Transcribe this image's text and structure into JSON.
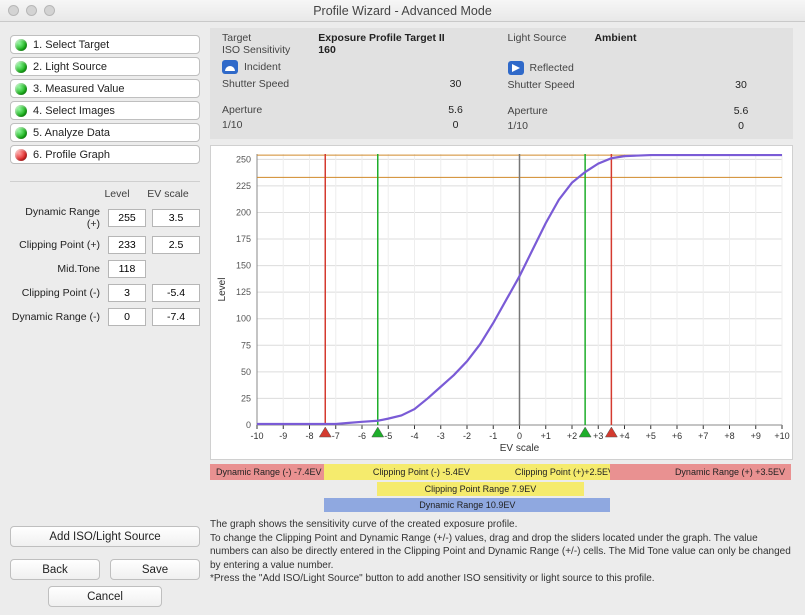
{
  "window": {
    "title": "Profile Wizard - Advanced Mode"
  },
  "nav": {
    "items": [
      {
        "label": "1. Select Target",
        "state": "green"
      },
      {
        "label": "2. Light Source",
        "state": "green"
      },
      {
        "label": "3. Measured Value",
        "state": "green"
      },
      {
        "label": "4. Select Images",
        "state": "green"
      },
      {
        "label": "5. Analyze Data",
        "state": "green"
      },
      {
        "label": "6. Profile Graph",
        "state": "red"
      }
    ]
  },
  "form": {
    "hdr_level": "Level",
    "hdr_evscale": "EV scale",
    "dr_plus_label": "Dynamic Range (+)",
    "dr_plus_level": "255",
    "dr_plus_ev": "3.5",
    "cp_plus_label": "Clipping Point (+)",
    "cp_plus_level": "233",
    "cp_plus_ev": "2.5",
    "mid_label": "Mid.Tone",
    "mid_level": "118",
    "cp_minus_label": "Clipping Point (-)",
    "cp_minus_level": "3",
    "cp_minus_ev": "-5.4",
    "dr_minus_label": "Dynamic Range (-)",
    "dr_minus_level": "0",
    "dr_minus_ev": "-7.4"
  },
  "buttons": {
    "add": "Add ISO/Light Source",
    "back": "Back",
    "save": "Save",
    "cancel": "Cancel"
  },
  "meta": {
    "target_label": "Target",
    "iso_label": "ISO Sensitivity",
    "exposure_label": "Exposure Profile Target II",
    "exposure_value": "160",
    "light_label": "Light Source",
    "light_value": "Ambient",
    "incident_label": "Incident",
    "reflected_label": "Reflected",
    "inc": {
      "shutter_label": "Shutter Speed",
      "shutter": "30",
      "aperture_label": "Aperture",
      "aperture": "5.6",
      "tenth_label": "1/10",
      "tenth": "0"
    },
    "ref": {
      "shutter_label": "Shutter Speed",
      "shutter": "30",
      "aperture_label": "Aperture",
      "aperture": "5.6",
      "tenth_label": "1/10",
      "tenth": "0"
    }
  },
  "axis": {
    "ylabel": "Level",
    "xlabel": "EV scale",
    "yticks": [
      "0",
      "25",
      "50",
      "75",
      "100",
      "125",
      "150",
      "175",
      "200",
      "225",
      "250"
    ],
    "xticks": [
      "-10",
      "-9",
      "-8",
      "-7",
      "-6",
      "-5",
      "-4",
      "-3",
      "-2",
      "-1",
      "0",
      "+1",
      "+2",
      "+3",
      "+4",
      "+5",
      "+6",
      "+7",
      "+8",
      "+9",
      "+10"
    ]
  },
  "chart_data": {
    "type": "line",
    "xlabel": "EV scale",
    "ylabel": "Level",
    "xlim": [
      -10,
      10
    ],
    "ylim": [
      0,
      255
    ],
    "series": [
      {
        "name": "sensitivity",
        "x": [
          -10,
          -9,
          -8,
          -7,
          -6.5,
          -6,
          -5.4,
          -5,
          -4.5,
          -4,
          -3.5,
          -3,
          -2.5,
          -2,
          -1.5,
          -1,
          -0.5,
          0,
          0.5,
          1,
          1.5,
          2,
          2.5,
          3,
          3.5,
          4,
          5,
          6,
          7,
          8,
          9,
          10
        ],
        "y": [
          1,
          1,
          1,
          1,
          2,
          3,
          4,
          6,
          9,
          15,
          25,
          36,
          47,
          60,
          76,
          96,
          118,
          140,
          165,
          190,
          212,
          228,
          238,
          246,
          251,
          253,
          254,
          254,
          254,
          254,
          254,
          254
        ]
      }
    ],
    "markers": {
      "dynamic_range_minus_ev": -7.4,
      "clipping_point_minus_ev": -5.4,
      "clipping_point_plus_ev": 2.5,
      "dynamic_range_plus_ev": 3.5
    },
    "clipping_point_plus_level": 233
  },
  "legend": {
    "dr_minus": "Dynamic Range (-) -7.4EV",
    "cp_minus": "Clipping Point (-) -5.4EV",
    "cp_plus": "Clipping Point (+)+2.5EV",
    "dr_plus": "Dynamic Range (+) +3.5EV",
    "cpr": "Clipping Point Range    7.9EV",
    "dr": "Dynamic Range    10.9EV"
  },
  "help": {
    "l1": "The graph shows the sensitivity curve of the created exposure profile.",
    "l2": "To change the Clipping Point and Dynamic Range (+/-) values, drag and drop the sliders located under the graph. The value numbers can also be directly entered in the Clipping Point and Dynamic Range (+/-) cells. The Mid Tone value can only be changed by entering a value number.",
    "l3": "*Press the \"Add ISO/Light Source\" button to add another ISO sensitivity or light source to this profile."
  },
  "colors": {
    "curve": "#7a5bd6",
    "marker_green": "#1eae2a",
    "marker_red": "#d43a2f",
    "clip_line": "#d08a2a"
  }
}
